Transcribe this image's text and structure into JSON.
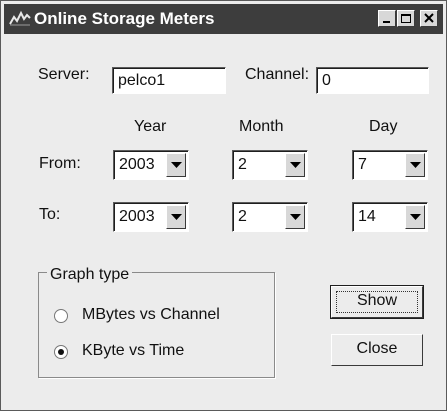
{
  "window": {
    "title": "Online Storage Meters",
    "minimize_glyph": "_",
    "maximize_glyph": "□",
    "close_glyph": "X"
  },
  "server": {
    "label": "Server:",
    "value": "pelco1"
  },
  "channel": {
    "label": "Channel:",
    "value": "0"
  },
  "columns": {
    "year": "Year",
    "month": "Month",
    "day": "Day"
  },
  "from": {
    "label": "From:",
    "year": "2003",
    "month": "2",
    "day": "7"
  },
  "to": {
    "label": "To:",
    "year": "2003",
    "month": "2",
    "day": "14"
  },
  "graph_type": {
    "title": "Graph type",
    "options": [
      {
        "label": "MBytes vs Channel",
        "checked": false
      },
      {
        "label": "KByte vs Time",
        "checked": true
      }
    ]
  },
  "buttons": {
    "show": "Show",
    "close": "Close"
  },
  "icons": {
    "app": "meter-wave-icon",
    "dropdown": "chevron-down-icon"
  }
}
